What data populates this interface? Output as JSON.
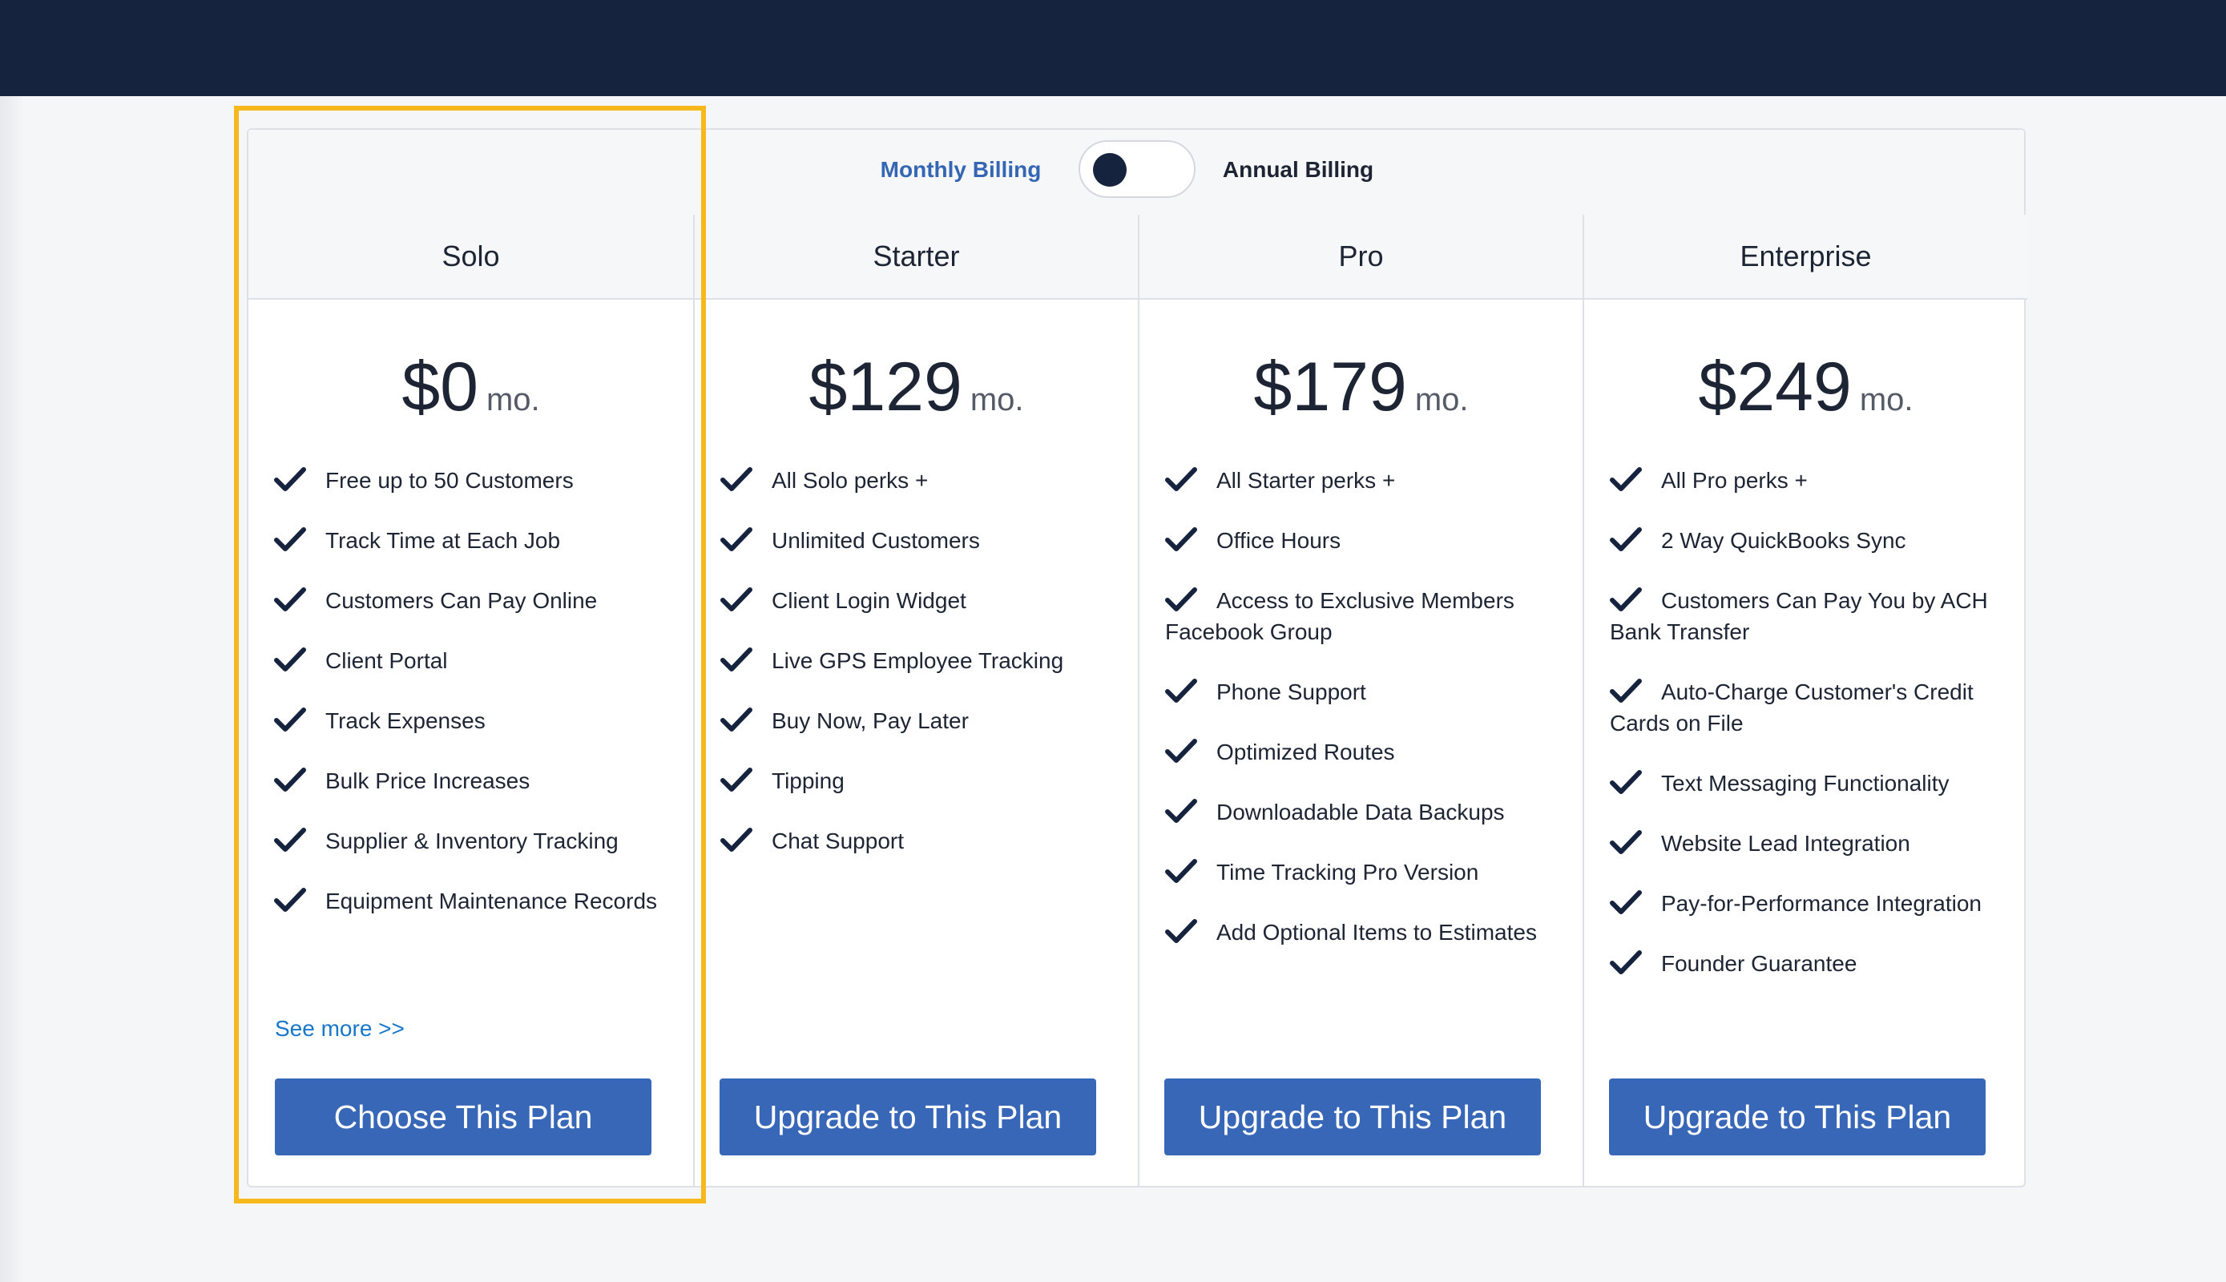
{
  "billing": {
    "monthly_label": "Monthly Billing",
    "annual_label": "Annual Billing",
    "toggle_state": "monthly"
  },
  "plans": [
    {
      "name": "Solo",
      "price": "$0",
      "unit": "mo.",
      "features": [
        "Free up to 50 Customers",
        "Track Time at Each Job",
        "Customers Can Pay Online",
        "Client Portal",
        "Track Expenses",
        "Bulk Price Increases",
        "Supplier & Inventory Tracking",
        "Equipment Maintenance Records"
      ],
      "see_more": "See more >>",
      "button": "Choose This Plan"
    },
    {
      "name": "Starter",
      "price": "$129",
      "unit": "mo.",
      "features": [
        "All Solo perks +",
        "Unlimited Customers",
        "Client Login Widget",
        "Live GPS Employee Tracking",
        "Buy Now, Pay Later",
        "Tipping",
        "Chat Support"
      ],
      "button": "Upgrade to This Plan"
    },
    {
      "name": "Pro",
      "price": "$179",
      "unit": "mo.",
      "features": [
        "All Starter perks +",
        "Office Hours",
        "Access to Exclusive Members Facebook Group",
        "Phone Support",
        "Optimized Routes",
        "Downloadable Data Backups",
        "Time Tracking Pro Version",
        "Add Optional Items to Estimates"
      ],
      "button": "Upgrade to This Plan"
    },
    {
      "name": "Enterprise",
      "price": "$249",
      "unit": "mo.",
      "features": [
        "All Pro perks +",
        "2 Way QuickBooks Sync",
        "Customers Can Pay You by ACH Bank Transfer",
        "Auto-Charge Customer's Credit Cards on File",
        "Text Messaging Functionality",
        "Website Lead Integration",
        "Pay-for-Performance Integration",
        "Founder Guarantee"
      ],
      "button": "Upgrade to This Plan"
    }
  ],
  "colors": {
    "topbar": "#16233f",
    "accent_blue": "#3867b7",
    "link_blue": "#1877c9",
    "highlight": "#f6b81c",
    "check": "#16233f"
  }
}
